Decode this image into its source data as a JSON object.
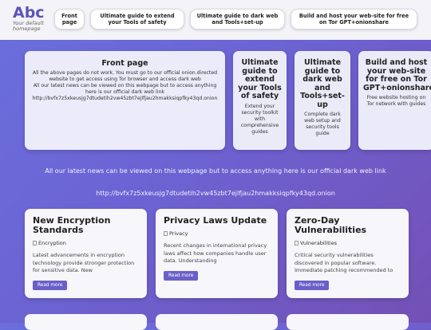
{
  "header": {
    "logo_title": "Abc",
    "logo_tagline": "Your default homepage",
    "nav": [
      {
        "label": "Front page"
      },
      {
        "label": "Ultimate guide to extend your Tools of safety"
      },
      {
        "label": "Ultimate guide to dark web and Tools+set-up"
      },
      {
        "label": "Build and host your web-site for free on Tor GPT+onionshare"
      }
    ]
  },
  "top_cards": [
    {
      "title": "Front page",
      "text": "All the above pages do not work, You must go to our official onion.directed website to get access using Tor browser and access dark web\nAll our latest news can be viewed on this webpage but to access anything here is our official dark web link\nhttp://bvfx7z5xkeusjg7dtudetih2vw45zbt7ejlfjau2hmakksiqpfky43qd.onion"
    },
    {
      "title": "Ultimate guide to extend your Tools of safety",
      "text": "Extend your security toolkit with comprehensive guides"
    },
    {
      "title": "Ultimate guide to dark web and Tools+set-up",
      "text": "Complete dark web setup and security tools guide"
    },
    {
      "title": "Build and host your web-site for free on Tor GPT+onionshare",
      "text": "Free website hosting on Tor network with guides"
    }
  ],
  "middle": {
    "line1": "All our latest news can be viewed on this webpage but to access anything here is our official dark web link",
    "link": "http://bvfx7z5xkeusjg7dtudetih2vw45zbt7ejlfjau2hmakksiqpfky43qd.onion"
  },
  "news": [
    {
      "title": "New Encryption Standards",
      "img_alt": "Encryption",
      "text": "Latest advancements in encryption technology provide stronger protection for sensitive data. New",
      "button": "Read more"
    },
    {
      "title": "Privacy Laws Update",
      "img_alt": "Privacy",
      "text": "Recent changes in international privacy laws affect how companies handle user data. Understanding",
      "button": "Read more"
    },
    {
      "title": "Zero-Day Vulnerabilities",
      "img_alt": "Vulnerabilities",
      "text": "Critical security vulnerabilities discovered in popular software. Immediate patching recommended to",
      "button": "Read more"
    }
  ],
  "colors": {
    "accent": "#5b55b8",
    "button": "#6a5fc8",
    "background_start": "#6a6fdd",
    "background_end": "#7450b5"
  }
}
